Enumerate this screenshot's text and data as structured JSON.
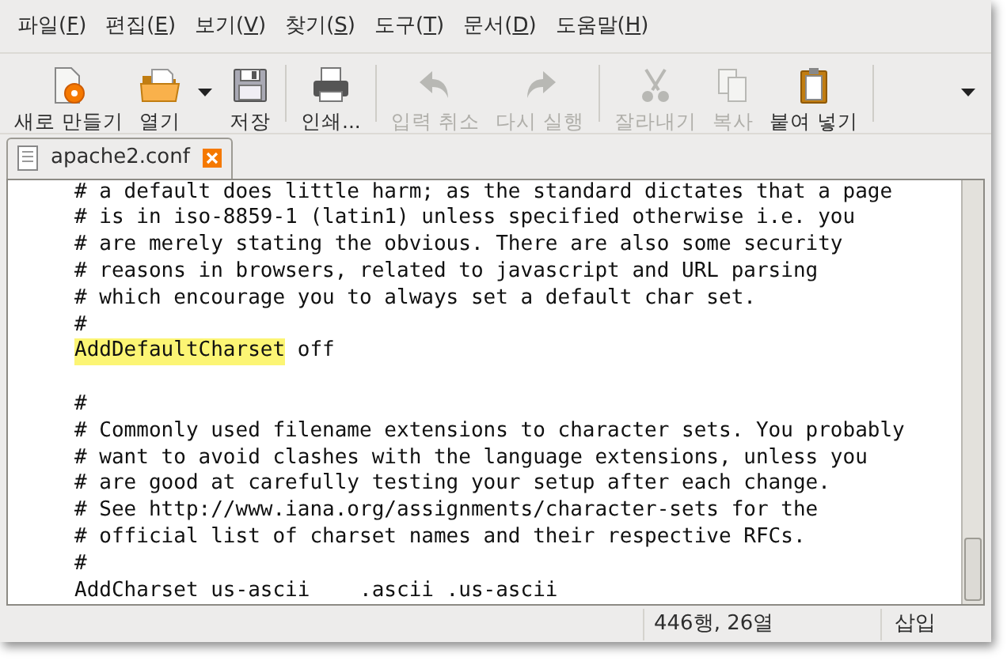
{
  "menu": [
    {
      "before": "파일(",
      "key": "F",
      "after": ")"
    },
    {
      "before": "편집(",
      "key": "E",
      "after": ")"
    },
    {
      "before": "보기(",
      "key": "V",
      "after": ")"
    },
    {
      "before": "찾기(",
      "key": "S",
      "after": ")"
    },
    {
      "before": "도구(",
      "key": "T",
      "after": ")"
    },
    {
      "before": "문서(",
      "key": "D",
      "after": ")"
    },
    {
      "before": "도움말(",
      "key": "H",
      "after": ")"
    }
  ],
  "toolbar": [
    {
      "kind": "button",
      "label": "새로 만들기",
      "disabled": false
    },
    {
      "kind": "button",
      "label": "열기",
      "disabled": false
    },
    {
      "kind": "dropdown"
    },
    {
      "kind": "button",
      "label": "저장",
      "disabled": false
    },
    {
      "kind": "separator"
    },
    {
      "kind": "button",
      "label": "인쇄...",
      "disabled": false
    },
    {
      "kind": "separator"
    },
    {
      "kind": "button",
      "label": "입력 취소",
      "disabled": true
    },
    {
      "kind": "button",
      "label": "다시 실행",
      "disabled": true
    },
    {
      "kind": "separator"
    },
    {
      "kind": "button",
      "label": "잘라내기",
      "disabled": true
    },
    {
      "kind": "button",
      "label": "복사",
      "disabled": true
    },
    {
      "kind": "button",
      "label": "붙여 넣기",
      "disabled": false
    },
    {
      "kind": "separator"
    },
    {
      "kind": "dropdown"
    }
  ],
  "tabs": [
    {
      "label": "apache2.conf",
      "selected": true
    }
  ],
  "editor": {
    "lines": [
      {
        "text": "# a default does little harm; as the standard dictates that a page"
      },
      {
        "text": "# is in iso-8859-1 (latin1) unless specified otherwise i.e. you"
      },
      {
        "text": "# are merely stating the obvious. There are also some security"
      },
      {
        "text": "# reasons in browsers, related to javascript and URL parsing"
      },
      {
        "text": "# which encourage you to always set a default char set."
      },
      {
        "text": "#"
      },
      {
        "segments": [
          {
            "text": "AddDefaultCharset",
            "highlighted": true
          },
          {
            "text": " off",
            "highlighted": false
          }
        ]
      },
      {
        "kind": "blank"
      },
      {
        "text": "#"
      },
      {
        "text": "# Commonly used filename extensions to character sets. You probably"
      },
      {
        "text": "# want to avoid clashes with the language extensions, unless you"
      },
      {
        "text": "# are good at carefully testing your setup after each change."
      },
      {
        "text": "# See http://www.iana.org/assignments/character-sets for the"
      },
      {
        "text": "# official list of charset names and their respective RFCs."
      },
      {
        "text": "#"
      },
      {
        "text": "AddCharset us-ascii    .ascii .us-ascii"
      }
    ]
  },
  "status_bar": {
    "position": "446행, 26열",
    "mode": "삽입"
  }
}
